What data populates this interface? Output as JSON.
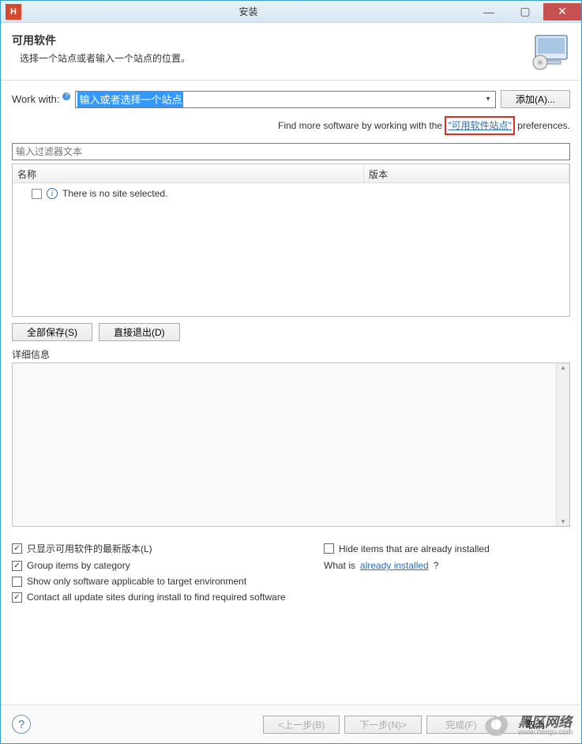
{
  "window": {
    "title": "安装",
    "app_icon_letter": "H"
  },
  "header": {
    "title": "可用软件",
    "subtitle": "选择一个站点或者输入一个站点的位置。"
  },
  "work_with": {
    "label": "Work with:",
    "value": "输入或者选择一个站点",
    "add_button": "添加(A)..."
  },
  "hint": {
    "before": "Find more software by working with the ",
    "link": "\"可用软件站点\"",
    "after": " preferences."
  },
  "filter_placeholder": "输入过滤器文本",
  "table": {
    "col_name": "名称",
    "col_version": "版本",
    "empty_msg": "There is no site selected."
  },
  "buttons": {
    "select_all": "全部保存(S)",
    "deselect_all": "直接退出(D)"
  },
  "details_label": "详细信息",
  "checks": {
    "latest": "只显示可用软件的最新版本(L)",
    "hide_installed": "Hide items that are already installed",
    "group": "Group items by category",
    "what_is": "What is ",
    "already_installed_link": "already installed",
    "show_applicable": "Show only software applicable to target environment",
    "contact": "Contact all update sites during install to find required software"
  },
  "footer": {
    "back": "<上一步(B)",
    "next": "下一步(N)>",
    "finish": "完成(F)",
    "cancel": "取消"
  },
  "watermark": {
    "name": "黑区网络",
    "url": "www.heiqu.com"
  }
}
